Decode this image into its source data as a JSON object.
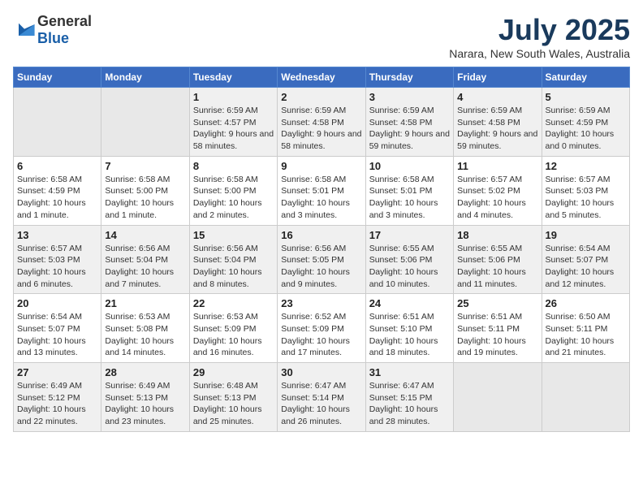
{
  "header": {
    "logo": {
      "general": "General",
      "blue": "Blue"
    },
    "title": "July 2025",
    "location": "Narara, New South Wales, Australia"
  },
  "weekdays": [
    "Sunday",
    "Monday",
    "Tuesday",
    "Wednesday",
    "Thursday",
    "Friday",
    "Saturday"
  ],
  "weeks": [
    [
      {
        "day": "",
        "empty": true
      },
      {
        "day": "",
        "empty": true
      },
      {
        "day": "1",
        "sunrise": "6:59 AM",
        "sunset": "4:57 PM",
        "daylight": "9 hours and 58 minutes."
      },
      {
        "day": "2",
        "sunrise": "6:59 AM",
        "sunset": "4:58 PM",
        "daylight": "9 hours and 58 minutes."
      },
      {
        "day": "3",
        "sunrise": "6:59 AM",
        "sunset": "4:58 PM",
        "daylight": "9 hours and 59 minutes."
      },
      {
        "day": "4",
        "sunrise": "6:59 AM",
        "sunset": "4:58 PM",
        "daylight": "9 hours and 59 minutes."
      },
      {
        "day": "5",
        "sunrise": "6:59 AM",
        "sunset": "4:59 PM",
        "daylight": "10 hours and 0 minutes."
      }
    ],
    [
      {
        "day": "6",
        "sunrise": "6:58 AM",
        "sunset": "4:59 PM",
        "daylight": "10 hours and 1 minute."
      },
      {
        "day": "7",
        "sunrise": "6:58 AM",
        "sunset": "5:00 PM",
        "daylight": "10 hours and 1 minute."
      },
      {
        "day": "8",
        "sunrise": "6:58 AM",
        "sunset": "5:00 PM",
        "daylight": "10 hours and 2 minutes."
      },
      {
        "day": "9",
        "sunrise": "6:58 AM",
        "sunset": "5:01 PM",
        "daylight": "10 hours and 3 minutes."
      },
      {
        "day": "10",
        "sunrise": "6:58 AM",
        "sunset": "5:01 PM",
        "daylight": "10 hours and 3 minutes."
      },
      {
        "day": "11",
        "sunrise": "6:57 AM",
        "sunset": "5:02 PM",
        "daylight": "10 hours and 4 minutes."
      },
      {
        "day": "12",
        "sunrise": "6:57 AM",
        "sunset": "5:03 PM",
        "daylight": "10 hours and 5 minutes."
      }
    ],
    [
      {
        "day": "13",
        "sunrise": "6:57 AM",
        "sunset": "5:03 PM",
        "daylight": "10 hours and 6 minutes."
      },
      {
        "day": "14",
        "sunrise": "6:56 AM",
        "sunset": "5:04 PM",
        "daylight": "10 hours and 7 minutes."
      },
      {
        "day": "15",
        "sunrise": "6:56 AM",
        "sunset": "5:04 PM",
        "daylight": "10 hours and 8 minutes."
      },
      {
        "day": "16",
        "sunrise": "6:56 AM",
        "sunset": "5:05 PM",
        "daylight": "10 hours and 9 minutes."
      },
      {
        "day": "17",
        "sunrise": "6:55 AM",
        "sunset": "5:06 PM",
        "daylight": "10 hours and 10 minutes."
      },
      {
        "day": "18",
        "sunrise": "6:55 AM",
        "sunset": "5:06 PM",
        "daylight": "10 hours and 11 minutes."
      },
      {
        "day": "19",
        "sunrise": "6:54 AM",
        "sunset": "5:07 PM",
        "daylight": "10 hours and 12 minutes."
      }
    ],
    [
      {
        "day": "20",
        "sunrise": "6:54 AM",
        "sunset": "5:07 PM",
        "daylight": "10 hours and 13 minutes."
      },
      {
        "day": "21",
        "sunrise": "6:53 AM",
        "sunset": "5:08 PM",
        "daylight": "10 hours and 14 minutes."
      },
      {
        "day": "22",
        "sunrise": "6:53 AM",
        "sunset": "5:09 PM",
        "daylight": "10 hours and 16 minutes."
      },
      {
        "day": "23",
        "sunrise": "6:52 AM",
        "sunset": "5:09 PM",
        "daylight": "10 hours and 17 minutes."
      },
      {
        "day": "24",
        "sunrise": "6:51 AM",
        "sunset": "5:10 PM",
        "daylight": "10 hours and 18 minutes."
      },
      {
        "day": "25",
        "sunrise": "6:51 AM",
        "sunset": "5:11 PM",
        "daylight": "10 hours and 19 minutes."
      },
      {
        "day": "26",
        "sunrise": "6:50 AM",
        "sunset": "5:11 PM",
        "daylight": "10 hours and 21 minutes."
      }
    ],
    [
      {
        "day": "27",
        "sunrise": "6:49 AM",
        "sunset": "5:12 PM",
        "daylight": "10 hours and 22 minutes."
      },
      {
        "day": "28",
        "sunrise": "6:49 AM",
        "sunset": "5:13 PM",
        "daylight": "10 hours and 23 minutes."
      },
      {
        "day": "29",
        "sunrise": "6:48 AM",
        "sunset": "5:13 PM",
        "daylight": "10 hours and 25 minutes."
      },
      {
        "day": "30",
        "sunrise": "6:47 AM",
        "sunset": "5:14 PM",
        "daylight": "10 hours and 26 minutes."
      },
      {
        "day": "31",
        "sunrise": "6:47 AM",
        "sunset": "5:15 PM",
        "daylight": "10 hours and 28 minutes."
      },
      {
        "day": "",
        "empty": true
      },
      {
        "day": "",
        "empty": true
      }
    ]
  ],
  "labels": {
    "sunrise": "Sunrise:",
    "sunset": "Sunset:",
    "daylight": "Daylight:"
  }
}
